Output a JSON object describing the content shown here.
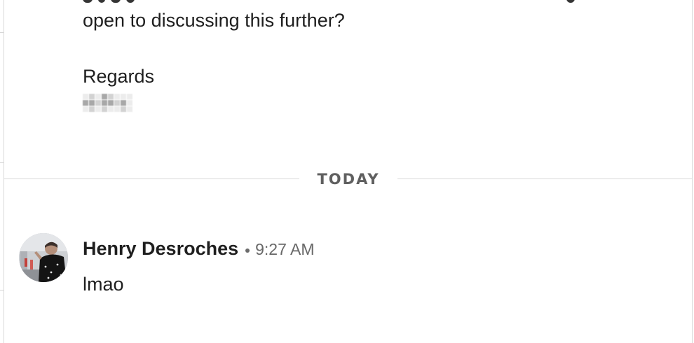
{
  "conversation": {
    "previous_message": {
      "lines": [
        "open to discussing this further?",
        "Regards"
      ]
    },
    "date_divider": "TODAY",
    "latest_message": {
      "sender": "Henry Desroches",
      "time": "9:27 AM",
      "text": "lmao",
      "avatar": "user-photo-avatar"
    }
  },
  "colors": {
    "background": "#ffffff",
    "text": "#1e1e1e",
    "divider": "#d9d9d9",
    "divider_label": "#5f5f5f",
    "timestamp": "#686868"
  }
}
